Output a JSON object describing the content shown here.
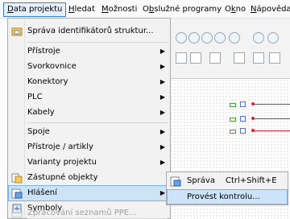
{
  "menubar": {
    "items": [
      {
        "label": "Data projektu",
        "accel": "D"
      },
      {
        "label": "Hledat",
        "accel": "H"
      },
      {
        "label": "Možnosti",
        "accel": "M"
      },
      {
        "label": "Obslužné programy",
        "accel": "b"
      },
      {
        "label": "Okno",
        "accel": "k"
      },
      {
        "label": "Nápověda",
        "accel": "N"
      }
    ]
  },
  "menu": {
    "items": [
      {
        "label": "Správa identifikátorů struktur...",
        "submenu": false,
        "icon": "folder-grid-icon"
      },
      {
        "label": "Přístroje",
        "submenu": true
      },
      {
        "label": "Svorkovnice",
        "submenu": true
      },
      {
        "label": "Konektory",
        "submenu": true
      },
      {
        "label": "PLC",
        "submenu": true
      },
      {
        "label": "Kabely",
        "submenu": true
      },
      {
        "label": "Spoje",
        "submenu": true
      },
      {
        "label": "Přístroje / artikly",
        "submenu": true
      },
      {
        "label": "Varianty projektu",
        "submenu": true
      },
      {
        "label": "Zástupné objekty",
        "submenu": false,
        "icon": "placeholder-objects-icon"
      },
      {
        "label": "Hlášení",
        "submenu": true,
        "icon": "messages-icon"
      },
      {
        "label": "Symboly",
        "submenu": false,
        "icon": "symbols-icon"
      },
      {
        "label": "Zpracování seznamů PPE...",
        "submenu": false,
        "disabled": true,
        "icon": "ppe-icon"
      }
    ]
  },
  "submenu": {
    "items": [
      {
        "label": "Správa",
        "shortcut": "Ctrl+Shift+E",
        "icon": "message-manage-icon"
      },
      {
        "label": "Provést kontrolu...",
        "shortcut": ""
      }
    ]
  },
  "colors": {
    "highlight": "#cde3f7",
    "highlight_border": "#7eb4ea",
    "wire": "#dd2233"
  }
}
